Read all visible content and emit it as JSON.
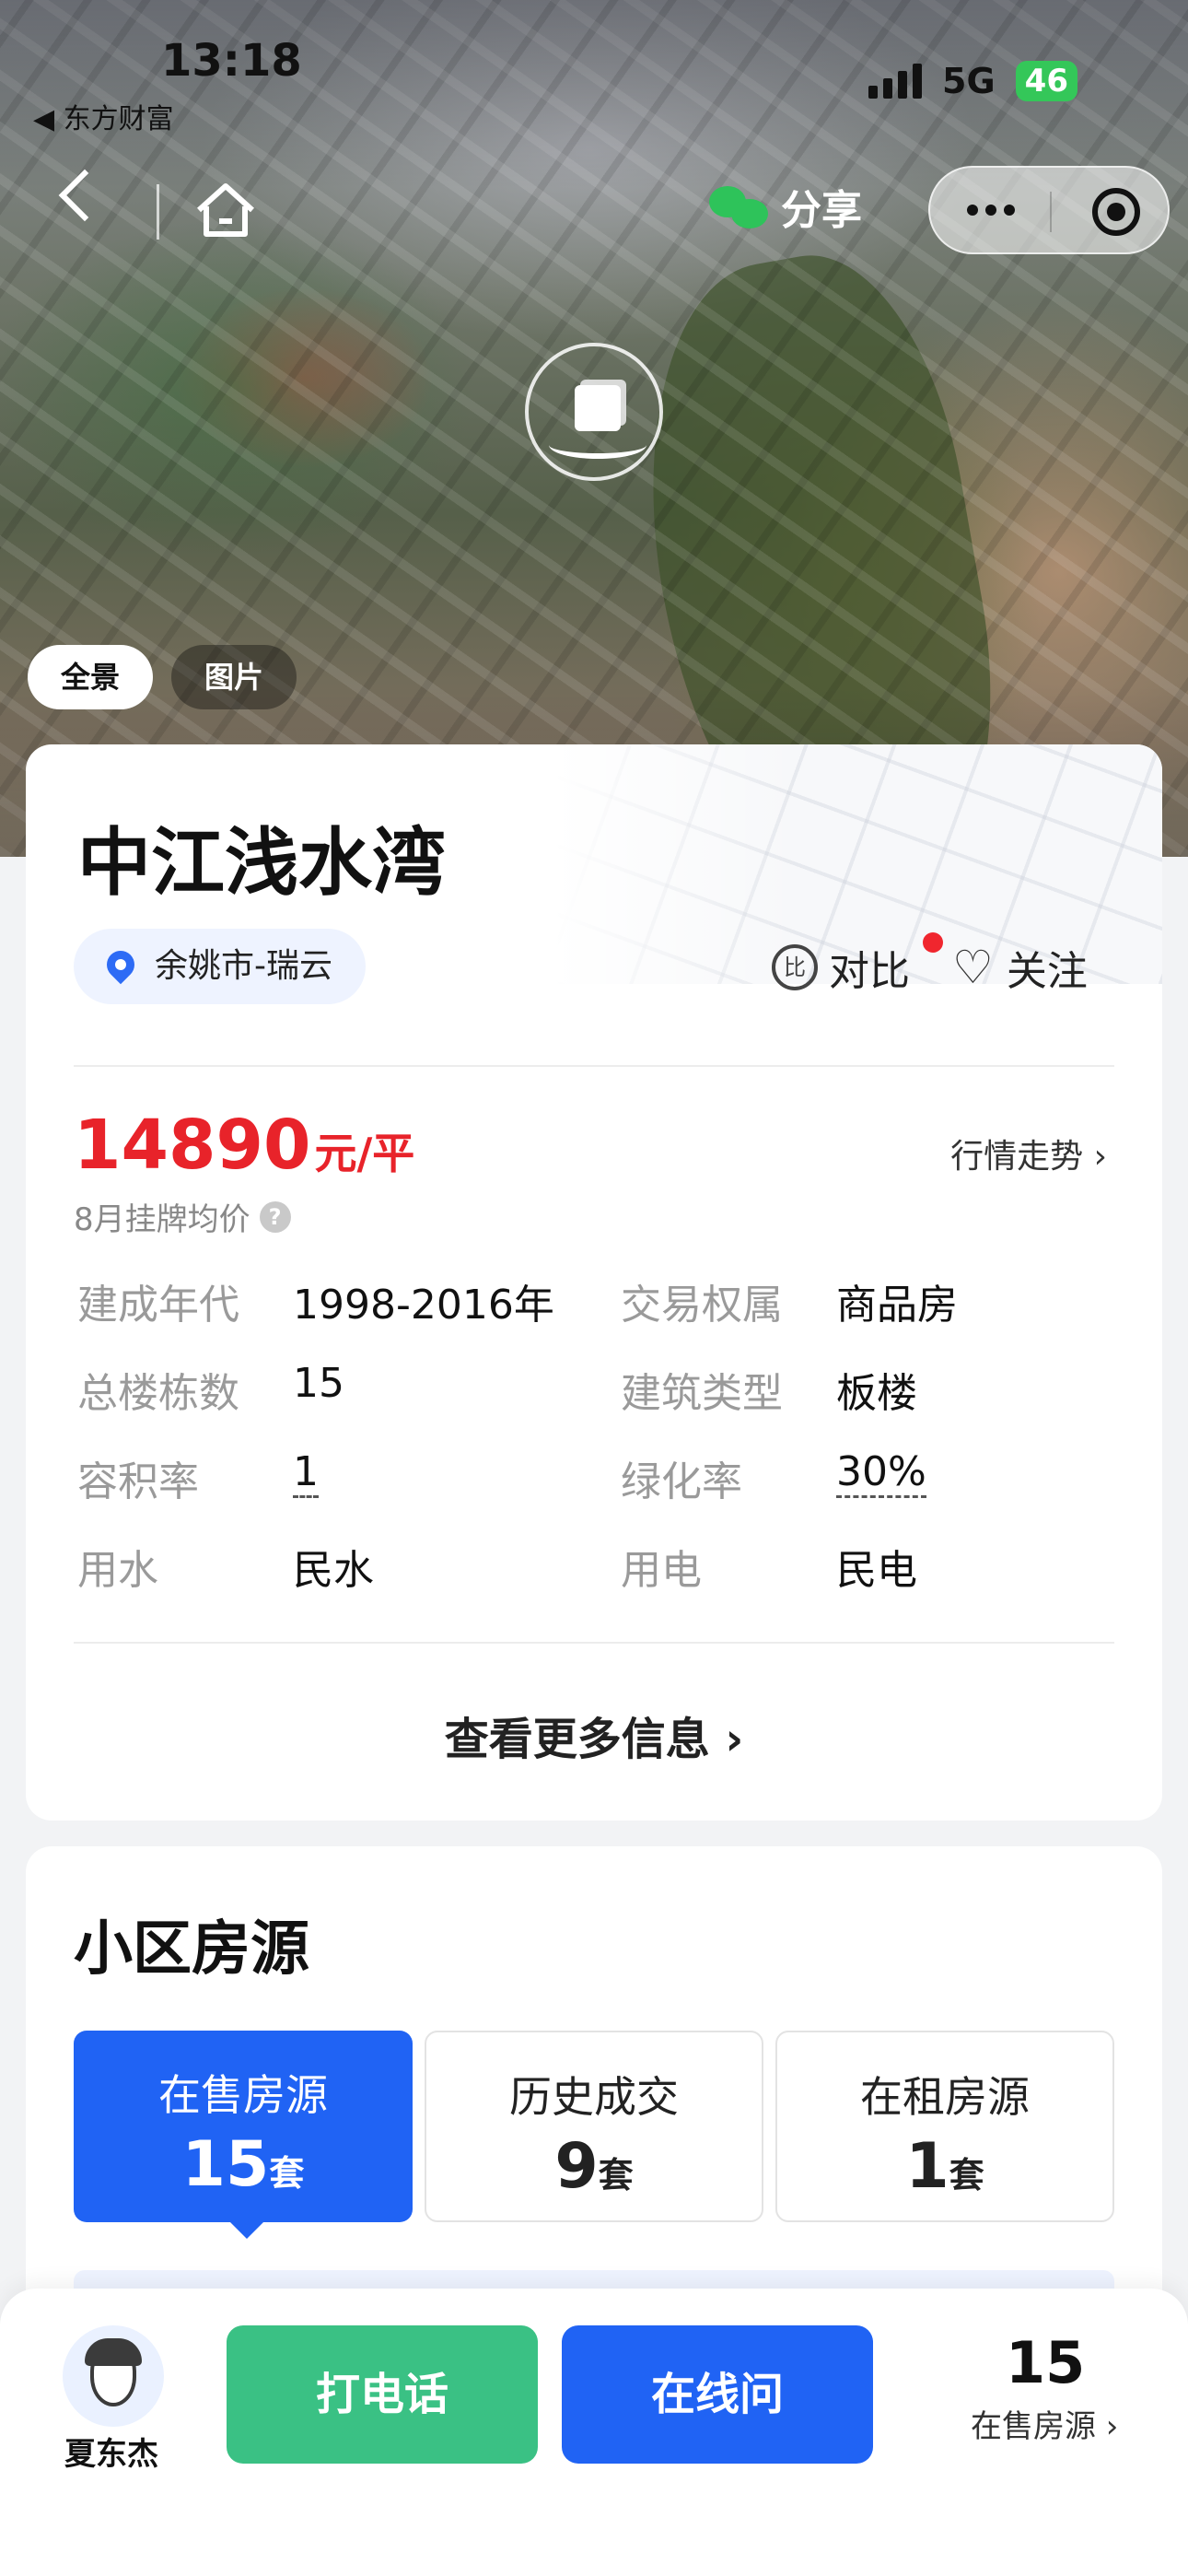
{
  "status": {
    "time": "13:18",
    "back_app": "◀ 东方财富",
    "network": "5G",
    "battery": "46"
  },
  "nav": {
    "share_label": "分享"
  },
  "hero": {
    "tabs": [
      {
        "label": "全景"
      },
      {
        "label": "图片"
      }
    ]
  },
  "community": {
    "name": "中江浅水湾",
    "location": "余姚市-瑞云",
    "compare_label": "对比",
    "follow_label": "关注",
    "price_value": "14890",
    "price_unit": "元/平",
    "price_note": "8月挂牌均价",
    "trend_label": "行情走势 ›",
    "attributes": [
      {
        "key": "建成年代",
        "value": "1998-2016年"
      },
      {
        "key": "交易权属",
        "value": "商品房"
      },
      {
        "key": "总楼栋数",
        "value": "15"
      },
      {
        "key": "建筑类型",
        "value": "板楼"
      },
      {
        "key": "容积率",
        "value": "1"
      },
      {
        "key": "绿化率",
        "value": "30%"
      },
      {
        "key": "用水",
        "value": "民水"
      },
      {
        "key": "用电",
        "value": "民电"
      }
    ],
    "more_label": "查看更多信息 ›"
  },
  "houses": {
    "title": "小区房源",
    "tabs": [
      {
        "label": "在售房源",
        "count": "15",
        "unit": "套"
      },
      {
        "label": "历史成交",
        "count": "9",
        "unit": "套"
      },
      {
        "label": "在租房源",
        "count": "1",
        "unit": "套"
      }
    ]
  },
  "bottom": {
    "agent_name": "夏东杰",
    "call_label": "打电话",
    "ask_label": "在线问",
    "sale_count": "15",
    "sale_label": "在售房源 ›"
  },
  "colors": {
    "primary": "#2063f4",
    "call_green": "#3ac184",
    "price_red": "#e8232a"
  }
}
